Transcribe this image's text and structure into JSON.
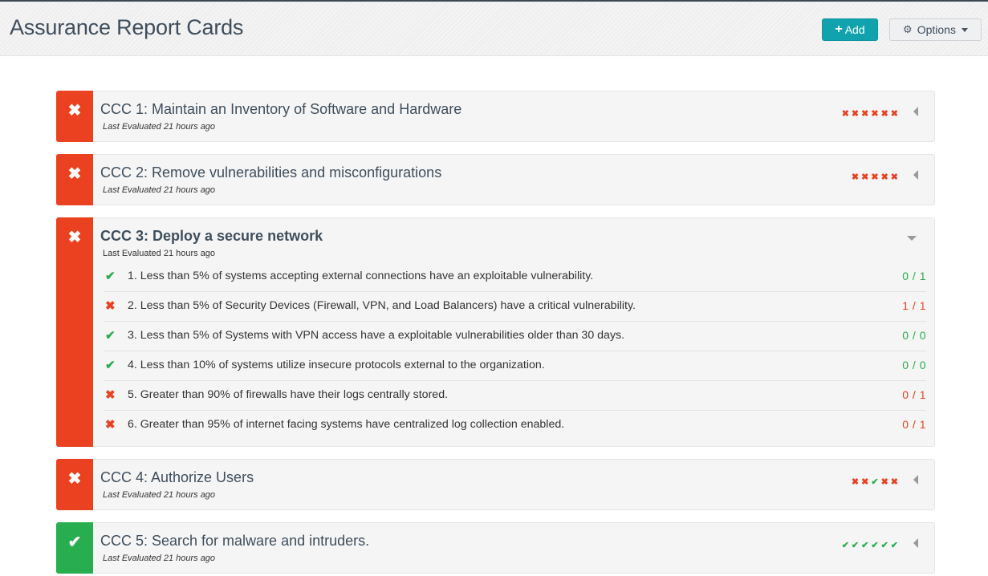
{
  "header": {
    "title": "Assurance Report Cards",
    "add_button": {
      "icon": "plus-icon",
      "label": "Add"
    },
    "options_button": {
      "icon": "gear-icon",
      "label": "Options",
      "caret": "caret-down-icon"
    }
  },
  "colors": {
    "fail": "#ea4220",
    "pass": "#28ae4f",
    "accent": "#11a3ad"
  },
  "cards": [
    {
      "title": "CCC 1: Maintain an Inventory of Software and Hardware",
      "status": "fail",
      "status_icon": "✖",
      "evaluated": "Last Evaluated 21 hours ago",
      "expanded": false,
      "marks": [
        "fail",
        "fail",
        "fail",
        "fail",
        "fail",
        "fail"
      ]
    },
    {
      "title": "CCC 2: Remove vulnerabilities and misconfigurations",
      "status": "fail",
      "status_icon": "✖",
      "evaluated": "Last Evaluated 21 hours ago",
      "expanded": false,
      "marks": [
        "fail",
        "fail",
        "fail",
        "fail",
        "fail"
      ]
    },
    {
      "title": "CCC 3: Deploy a secure network",
      "status": "fail",
      "status_icon": "✖",
      "evaluated": "Last Evaluated 21 hours ago",
      "expanded": true,
      "items": [
        {
          "status": "pass",
          "text": "1. Less than 5% of systems accepting external connections have an exploitable vulnerability.",
          "ratio": "0 / 1"
        },
        {
          "status": "fail",
          "text": "2. Less than 5% of Security Devices (Firewall, VPN, and Load Balancers) have a critical vulnerability.",
          "ratio": "1 / 1"
        },
        {
          "status": "pass",
          "text": "3. Less than 5% of Systems with VPN access have a exploitable vulnerabilities older than 30 days.",
          "ratio": "0 / 0"
        },
        {
          "status": "pass",
          "text": "4. Less than 10% of systems utilize insecure protocols external to the organization.",
          "ratio": "0 / 0"
        },
        {
          "status": "fail",
          "text": "5. Greater than 90% of firewalls have their logs centrally stored.",
          "ratio": "0 / 1"
        },
        {
          "status": "fail",
          "text": "6. Greater than 95% of internet facing systems have centralized log collection enabled.",
          "ratio": "0 / 1"
        }
      ]
    },
    {
      "title": "CCC 4: Authorize Users",
      "status": "fail",
      "status_icon": "✖",
      "evaluated": "Last Evaluated 21 hours ago",
      "expanded": false,
      "marks": [
        "fail",
        "fail",
        "pass",
        "fail",
        "fail"
      ]
    },
    {
      "title": "CCC 5: Search for malware and intruders.",
      "status": "pass",
      "status_icon": "✔",
      "evaluated": "Last Evaluated 21 hours ago",
      "expanded": false,
      "marks": [
        "pass",
        "pass",
        "pass",
        "pass",
        "pass",
        "pass"
      ]
    }
  ]
}
